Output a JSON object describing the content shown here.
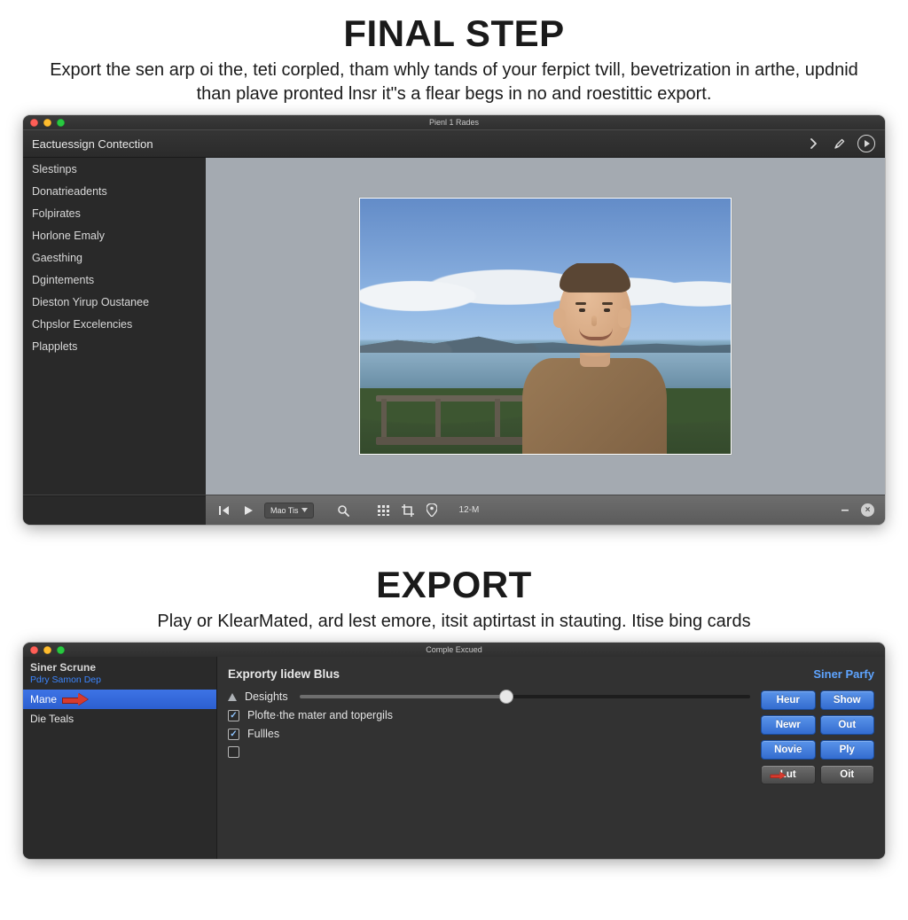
{
  "section1": {
    "title": "FINAL STEP",
    "subtitle": "Export the sen arp oi the, teti corpled, tham whly tands of your ferpict tvill, bevetrization in arthe, updnid than plave pronted lnsr it\"s a flear begs in no and roestittic export."
  },
  "section2": {
    "title": "EXPORT",
    "subtitle": "Play or KlearMated, ard lest emore, itsit aptirtast in stauting. Itise bing cards"
  },
  "window1": {
    "title": "Pienl 1 Rades",
    "toolbar": {
      "label": "Eactuessign Contection"
    },
    "sidebar": [
      "Slestinps",
      "Donatrieadents",
      "Folpirates",
      "Horlone Emaly",
      "Gaesthing",
      "Dgintements",
      "Dieston Yirup Oustanee",
      "Chpslor Excelencies",
      "Plapplets"
    ],
    "footer": {
      "mode_label": "Mao Tis",
      "time_label": "12-M"
    }
  },
  "window2": {
    "title": "Comple Excued",
    "sidebar": {
      "group_title": "Siner Scrune",
      "group_sub": "Pdry Samon Dep",
      "items": [
        "Mane",
        "Die Teals"
      ],
      "selected_index": 0
    },
    "panel": {
      "heading": "Exprorty lidew Blus",
      "right_label": "Siner Parfy",
      "options": [
        {
          "kind": "slider",
          "label": "Desights",
          "value": 46
        },
        {
          "kind": "check",
          "label": "Plofte·the mater and topergils",
          "checked": true
        },
        {
          "kind": "check",
          "label": "Fullles",
          "checked": true
        },
        {
          "kind": "check",
          "label": "",
          "checked": false
        }
      ],
      "buttons": [
        {
          "label": "Heur",
          "style": "blue"
        },
        {
          "label": "Show",
          "style": "blue"
        },
        {
          "label": "Newr",
          "style": "blue"
        },
        {
          "label": "Out",
          "style": "blue"
        },
        {
          "label": "Novie",
          "style": "blue"
        },
        {
          "label": "Ply",
          "style": "blue"
        },
        {
          "label": "Lut",
          "style": "gray",
          "arrow": true
        },
        {
          "label": "Oit",
          "style": "gray"
        }
      ]
    }
  }
}
